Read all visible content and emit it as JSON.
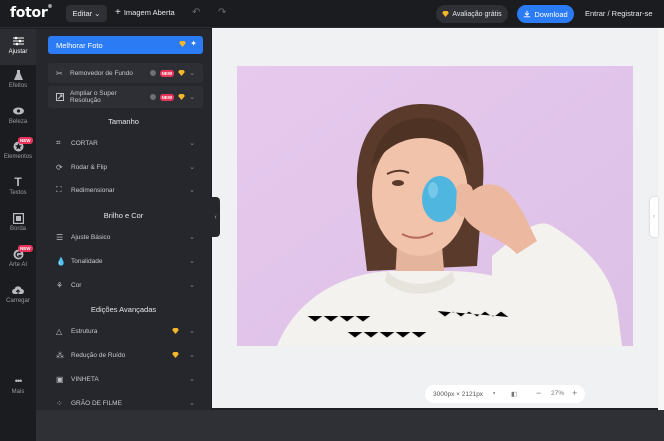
{
  "header": {
    "logo": "fotor",
    "logo_mark": "®",
    "edit_label": "Editar",
    "open_image_label": "Imagem Aberta",
    "trial_label": "Avaliação grátis",
    "download_label": "Download",
    "login_label": "Entrar / Registrar-se"
  },
  "rail": {
    "items": [
      {
        "label": "Ajustar",
        "icon": "sliders-icon",
        "active": true
      },
      {
        "label": "Efeitos",
        "icon": "flask-icon"
      },
      {
        "label": "Beleza",
        "icon": "eye-icon"
      },
      {
        "label": "Elementos",
        "icon": "shapes-icon",
        "badge": "NEW"
      },
      {
        "label": "Textos",
        "icon": "text-icon"
      },
      {
        "label": "Borda",
        "icon": "frame-icon"
      },
      {
        "label": "Arte AI",
        "icon": "ai-art-icon",
        "badge": "NEW"
      },
      {
        "label": "Carregar",
        "icon": "upload-icon"
      },
      {
        "label": "Mais",
        "icon": "more-icon"
      }
    ]
  },
  "panel": {
    "enhance_label": "Melhorar Foto",
    "remove_bg_label": "Removedor de Fundo",
    "upscale_label_1": "Ampliar o Super",
    "upscale_label_2": "Resolução",
    "new_badge": "NEW",
    "sections": {
      "size": "Tamanho",
      "light": "Brilho e Cor",
      "advanced": "Edições Avançadas"
    },
    "size_items": [
      "CORTAR",
      "Rodar & Flip",
      "Redimensionar"
    ],
    "light_items": [
      "Ajuste Básico",
      "Tonalidade",
      "Cor"
    ],
    "advanced_items": [
      "Estrutura",
      "Redução de Ruído",
      "VINHETA",
      "GRÃO DE FILME"
    ]
  },
  "canvas": {
    "dimensions": "3000px × 2121px",
    "zoom": "27%",
    "photo_bg": "#e4c6ea",
    "egg_color": "#4fb6e0"
  },
  "colors": {
    "accent": "#2b7bf5",
    "new_badge": "#e8345a",
    "gem": "#f3b72b"
  }
}
